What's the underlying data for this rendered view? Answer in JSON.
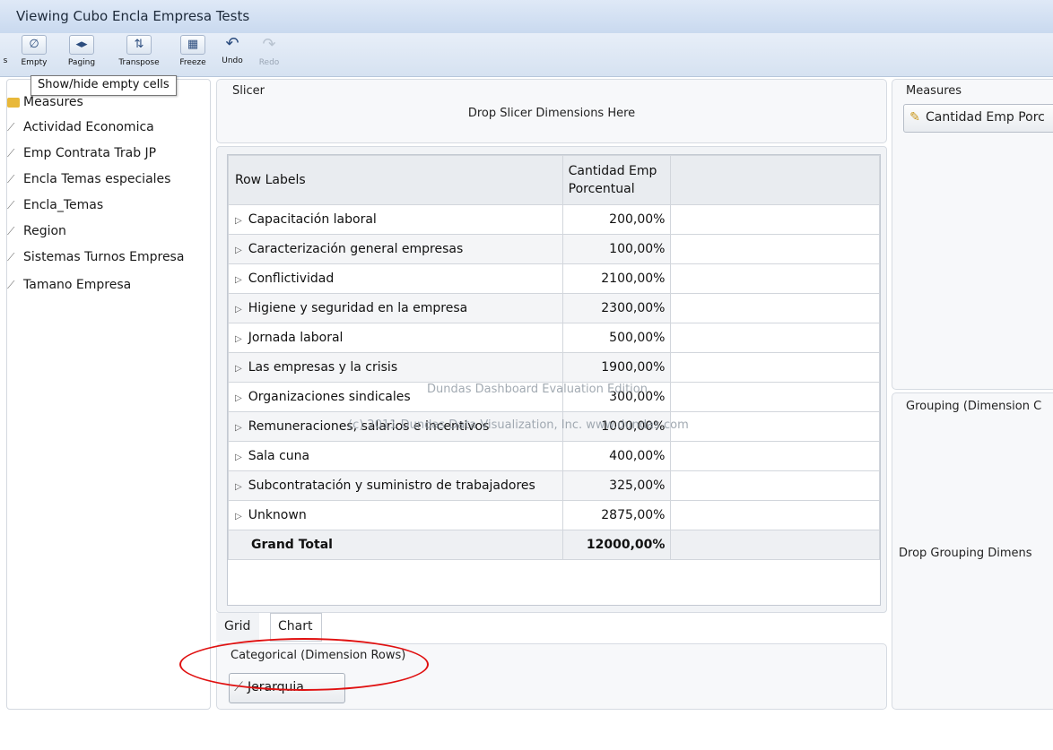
{
  "window": {
    "title": "Viewing Cubo Encla Empresa Tests"
  },
  "toolbar": {
    "buttons": [
      {
        "label": "s",
        "icon": "partial-icon"
      },
      {
        "label": "Empty",
        "icon": "empty-cells-icon"
      },
      {
        "label": "Paging",
        "icon": "paging-icon"
      },
      {
        "label": "Transpose",
        "icon": "transpose-icon"
      },
      {
        "label": "Freeze",
        "icon": "freeze-icon"
      },
      {
        "label": "Undo",
        "icon": "undo-icon"
      },
      {
        "label": "Redo",
        "icon": "redo-icon"
      }
    ]
  },
  "tooltip": {
    "text": "Show/hide empty cells"
  },
  "dimensions": [
    {
      "label": "Measures",
      "type": "measure"
    },
    {
      "label": "Actividad Economica",
      "type": "hierarchy"
    },
    {
      "label": "Emp Contrata Trab JP",
      "type": "hierarchy"
    },
    {
      "label": "Encla Temas especiales",
      "type": "hierarchy"
    },
    {
      "label": "Encla_Temas",
      "type": "hierarchy"
    },
    {
      "label": "Region",
      "type": "hierarchy"
    },
    {
      "label": "Sistemas Turnos Empresa",
      "type": "hierarchy"
    },
    {
      "label": "Tamano Empresa",
      "type": "hierarchy"
    }
  ],
  "slicer": {
    "title": "Slicer",
    "drop_text": "Drop Slicer Dimensions Here"
  },
  "grid": {
    "header_row_labels": "Row Labels",
    "header_measure": "Cantidad Emp Porcentual",
    "rows": [
      {
        "label": "Capacitación laboral",
        "value": "200,00%"
      },
      {
        "label": "Caracterización general empresas",
        "value": "100,00%"
      },
      {
        "label": "Conflictividad",
        "value": "2100,00%"
      },
      {
        "label": "Higiene y seguridad en la empresa",
        "value": "2300,00%"
      },
      {
        "label": "Jornada laboral",
        "value": "500,00%"
      },
      {
        "label": "Las empresas y la crisis",
        "value": "1900,00%"
      },
      {
        "label": "Organizaciones sindicales",
        "value": "300,00%"
      },
      {
        "label": "Remuneraciones, salarios e incentivos",
        "value": "1000,00%"
      },
      {
        "label": "Sala cuna",
        "value": "400,00%"
      },
      {
        "label": "Subcontratación y suministro de trabajadores",
        "value": "325,00%"
      },
      {
        "label": "Unknown",
        "value": "2875,00%"
      }
    ],
    "total": {
      "label": "Grand Total",
      "value": "12000,00%"
    },
    "watermark_line1": "Dundas Dashboard Evaluation Edition",
    "watermark_line2": "(c) 2011 Dundas Data Visualization, Inc. www.dundas.com"
  },
  "tabs": [
    {
      "label": "Grid"
    },
    {
      "label": "Chart"
    }
  ],
  "categorical": {
    "title": "Categorical (Dimension Rows)",
    "item": "Jerarquia"
  },
  "measures_panel": {
    "title": "Measures",
    "item": "Cantidad Emp Porc"
  },
  "grouping_panel": {
    "title": "Grouping (Dimension C",
    "drop_text": "Drop Grouping Dimens"
  },
  "colors": {
    "annotation": "#e01010",
    "toolbar": "#d6e2f1"
  }
}
